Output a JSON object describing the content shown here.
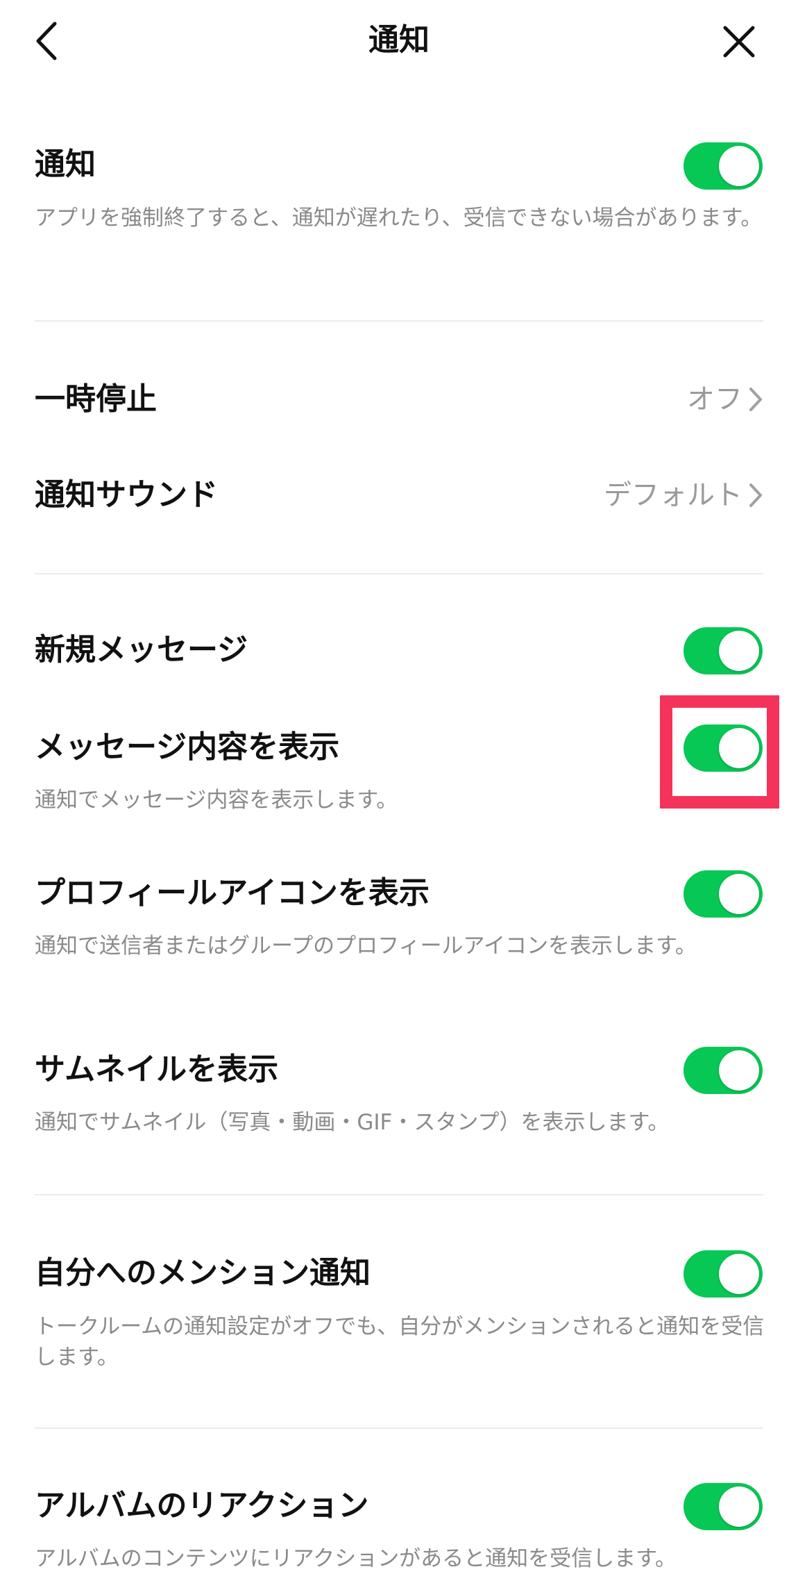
{
  "header": {
    "title": "通知"
  },
  "notification": {
    "title": "通知",
    "description": "アプリを強制終了すると、通知が遅れたり、受信できない場合があります。",
    "enabled": true
  },
  "pause": {
    "title": "一時停止",
    "value": "オフ"
  },
  "sound": {
    "title": "通知サウンド",
    "value": "デフォルト"
  },
  "new_message": {
    "title": "新規メッセージ",
    "enabled": true
  },
  "show_content": {
    "title": "メッセージ内容を表示",
    "description": "通知でメッセージ内容を表示します。",
    "enabled": true
  },
  "show_profile_icon": {
    "title": "プロフィールアイコンを表示",
    "description": "通知で送信者またはグループのプロフィールアイコンを表示します。",
    "enabled": true
  },
  "show_thumbnail": {
    "title": "サムネイルを表示",
    "description": "通知でサムネイル（写真・動画・GIF・スタンプ）を表示します。",
    "enabled": true
  },
  "mention": {
    "title": "自分へのメンション通知",
    "description": "トークルームの通知設定がオフでも、自分がメンションされると通知を受信します。",
    "enabled": true
  },
  "album_reaction": {
    "title": "アルバムのリアクション",
    "description": "アルバムのコンテンツにリアクションがあると通知を受信します。",
    "enabled": true
  },
  "colors": {
    "toggle_on": "#07c755",
    "highlight": "#f5335a",
    "secondary_text": "#8a8a8a"
  }
}
